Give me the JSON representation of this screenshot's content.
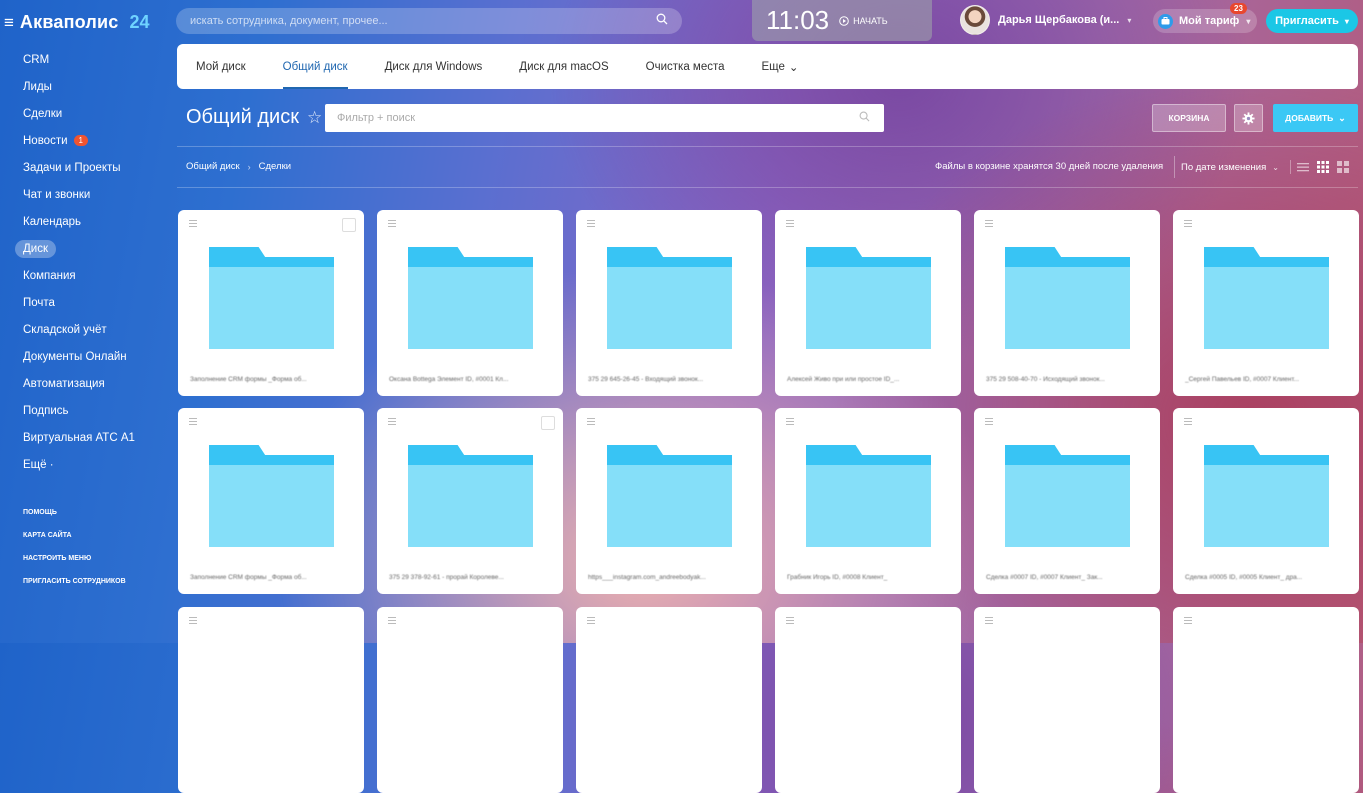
{
  "header": {
    "logo_name": "Акваполис",
    "logo_num": "24",
    "search_placeholder": "искать сотрудника, документ, прочее...",
    "clock_time": "11:03",
    "clock_action": "НАЧАТЬ",
    "user_name": "Дарья Щербакова (и...",
    "tariff_label": "Мой тариф",
    "tariff_badge": "23",
    "invite_label": "Пригласить"
  },
  "sidebar": {
    "items": [
      {
        "label": "CRM"
      },
      {
        "label": "Лиды"
      },
      {
        "label": "Сделки"
      },
      {
        "label": "Новости",
        "badge": "1"
      },
      {
        "label": "Задачи и Проекты"
      },
      {
        "label": "Чат и звонки"
      },
      {
        "label": "Календарь"
      },
      {
        "label": "Диск",
        "active": true
      },
      {
        "label": "Компания"
      },
      {
        "label": "Почта"
      },
      {
        "label": "Складской учёт"
      },
      {
        "label": "Документы Онлайн"
      },
      {
        "label": "Автоматизация"
      },
      {
        "label": "Подпись"
      },
      {
        "label": "Виртуальная АТС А1"
      },
      {
        "label": "Ещё ·"
      }
    ],
    "bottom": [
      "ПОМОЩЬ",
      "КАРТА САЙТА",
      "НАСТРОИТЬ МЕНЮ",
      "ПРИГЛАСИТЬ СОТРУДНИКОВ"
    ]
  },
  "tabs": [
    {
      "label": "Мой диск"
    },
    {
      "label": "Общий диск",
      "active": true
    },
    {
      "label": "Диск для Windows"
    },
    {
      "label": "Диск для macOS"
    },
    {
      "label": "Очистка места"
    },
    {
      "label": "Еще"
    }
  ],
  "toolbar": {
    "title": "Общий диск",
    "filter_placeholder": "Фильтр + поиск",
    "trash_label": "КОРЗИНА",
    "add_label": "ДОБАВИТЬ"
  },
  "breadcrumb": [
    "Общий диск",
    "Сделки"
  ],
  "notice": "Файлы в корзине хранятся 30 дней после удаления",
  "sort_label": "По дате изменения",
  "folders": [
    "Заполнение CRM формы _Форма об...",
    "Оксана Bottega Элемент ID, #0001 Кл...",
    "375 29 645-26-45 - Входящий звонок...",
    "Алексей Живо при или простое ID_...",
    "375 29 508-40-70 - Исходящий звонок...",
    "_Сергей Павельев ID, #0007 Клиент...",
    "Заполнение CRM формы _Форма об...",
    "375 29 378-92-61 - прорай Королеве...",
    "https___instagram.com_andreebodyak...",
    "Грабник Игорь ID, #0008 Клиент_",
    "Сделка #0007 ID, #0007 Клиент_ Зак...",
    "Сделка #0005 ID, #0005 Клиент_ дра..."
  ],
  "colors": {
    "accent": "#2067b0",
    "add_button": "#3bc8f5",
    "invite_button": "#1bc7e6",
    "folder_dark": "#38c4f4",
    "folder_light": "#85dff9",
    "badge": "#e8472f"
  }
}
